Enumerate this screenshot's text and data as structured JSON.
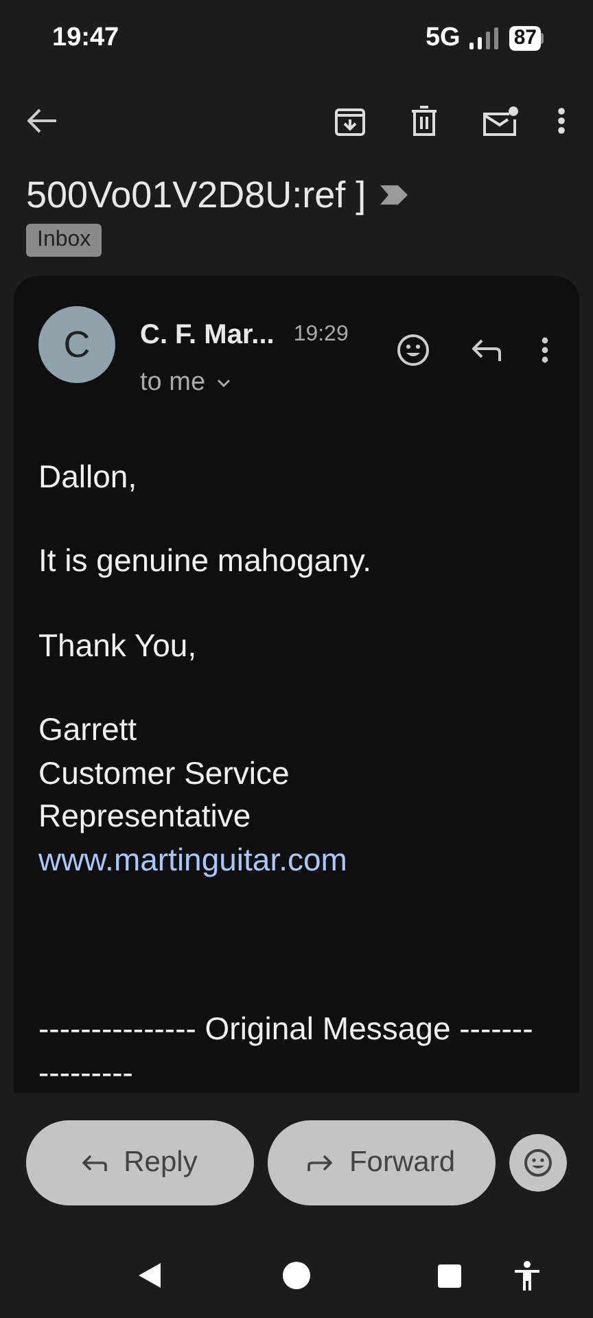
{
  "status_bar": {
    "time": "19:47",
    "network": "5G",
    "battery": "87"
  },
  "subject": {
    "text": "500Vo01V2D8U:ref ]",
    "important": true
  },
  "labels": [
    "Inbox"
  ],
  "message": {
    "sender_initial": "C",
    "sender": "C. F. Mar...",
    "time": "19:29",
    "recipient": "to me",
    "body": [
      {
        "kind": "text",
        "lines": [
          "Dallon,"
        ]
      },
      {
        "kind": "text",
        "lines": [
          "It is genuine mahogany."
        ]
      },
      {
        "kind": "text",
        "lines": [
          "Thank You,"
        ]
      },
      {
        "kind": "signature",
        "lines": [
          "Garrett",
          "Customer Service",
          "Representative"
        ],
        "link": "www.martinguitar.com"
      },
      {
        "kind": "quote",
        "lines": [
          "--------------- Original Message -------",
          "---------"
        ]
      }
    ]
  },
  "actions": [
    {
      "kind": "reply",
      "label": "Reply"
    },
    {
      "kind": "forward",
      "label": "Forward"
    }
  ]
}
